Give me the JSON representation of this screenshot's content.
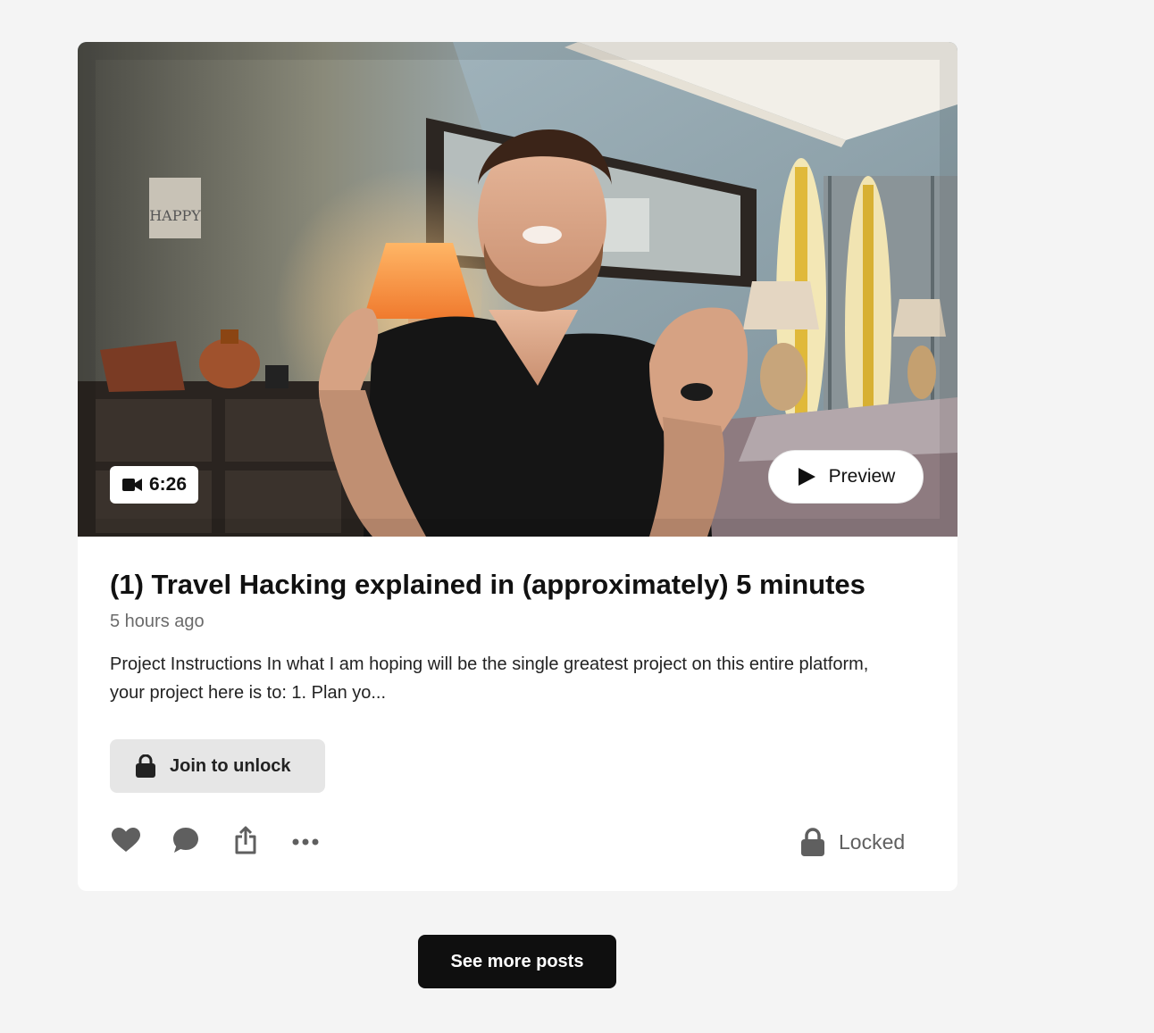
{
  "post": {
    "thumbnail_alt": "Man talking to camera in a room with a lamp and surfboards",
    "decor_sign_text": "HAPPY",
    "duration": "6:26",
    "duration_icon": "video-camera-icon",
    "preview_label": "Preview",
    "preview_icon": "play-icon",
    "title": "(1) Travel Hacking explained in (approximately) 5 minutes",
    "time_ago": "5 hours ago",
    "excerpt": "Project Instructions In what I am hoping will be the single greatest project on this entire platform, your project here is to: 1. Plan yo...",
    "unlock_label": "Join to unlock",
    "unlock_icon": "lock-icon",
    "actions": [
      {
        "icon": "heart-icon"
      },
      {
        "icon": "comment-icon"
      },
      {
        "icon": "share-icon"
      },
      {
        "icon": "more-icon"
      }
    ],
    "status_label": "Locked",
    "status_icon": "lock-icon"
  },
  "footer": {
    "see_more_label": "See more posts"
  },
  "colors": {
    "page_bg": "#f4f4f4",
    "card_bg": "#ffffff",
    "icon_gray": "#5f5f5f",
    "unlock_bg": "#e6e6e6",
    "see_more_bg": "#0f0f0f"
  }
}
